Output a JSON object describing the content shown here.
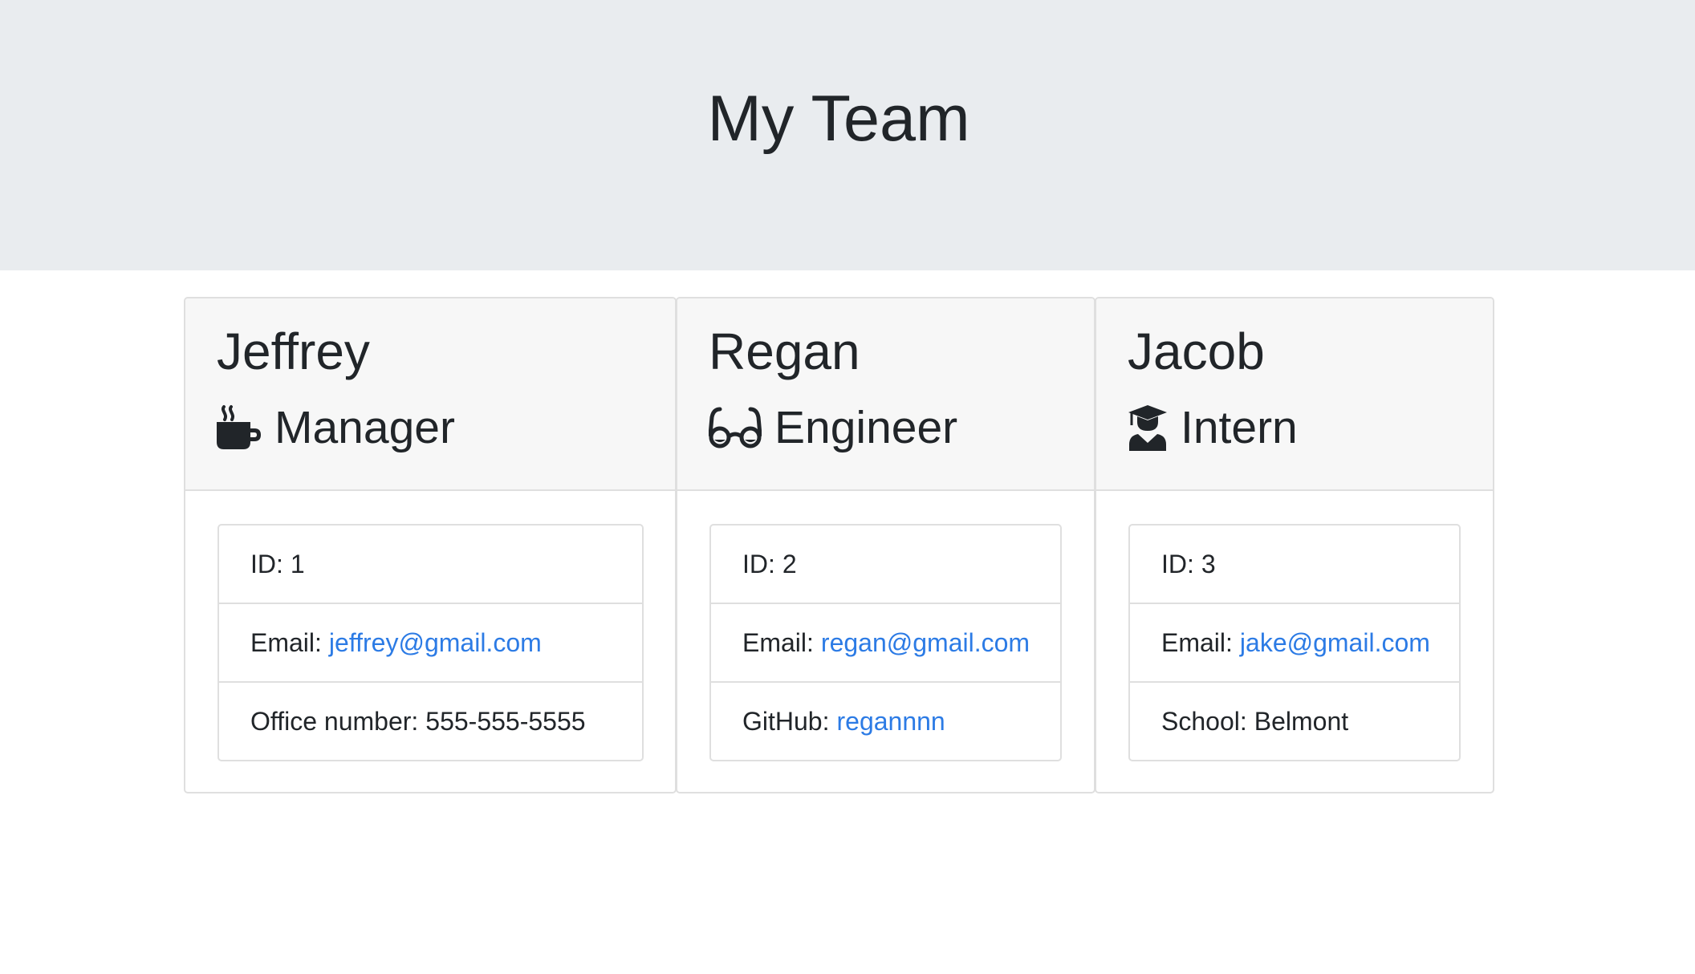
{
  "header": {
    "title": "My Team"
  },
  "employees": [
    {
      "name": "Jeffrey",
      "role": "Manager",
      "role_icon": "coffee-mug-icon",
      "id_label": "ID:",
      "id": "1",
      "email_label": "Email:",
      "email": "jeffrey@gmail.com",
      "extra_label": "Office number:",
      "extra": "555-555-5555"
    },
    {
      "name": "Regan",
      "role": "Engineer",
      "role_icon": "glasses-icon",
      "id_label": "ID:",
      "id": "2",
      "email_label": "Email:",
      "email": "regan@gmail.com",
      "extra_label": "GitHub:",
      "extra": "regannnn"
    },
    {
      "name": "Jacob",
      "role": "Intern",
      "role_icon": "graduate-icon",
      "id_label": "ID:",
      "id": "3",
      "email_label": "Email:",
      "email": "jake@gmail.com",
      "extra_label": "School:",
      "extra": "Belmont"
    }
  ],
  "colors": {
    "jumbotron_bg": "#e9ecef",
    "card_header_bg": "#f7f7f7",
    "link": "#2c7be5",
    "text": "#212529",
    "border": "#dfdfdf"
  }
}
